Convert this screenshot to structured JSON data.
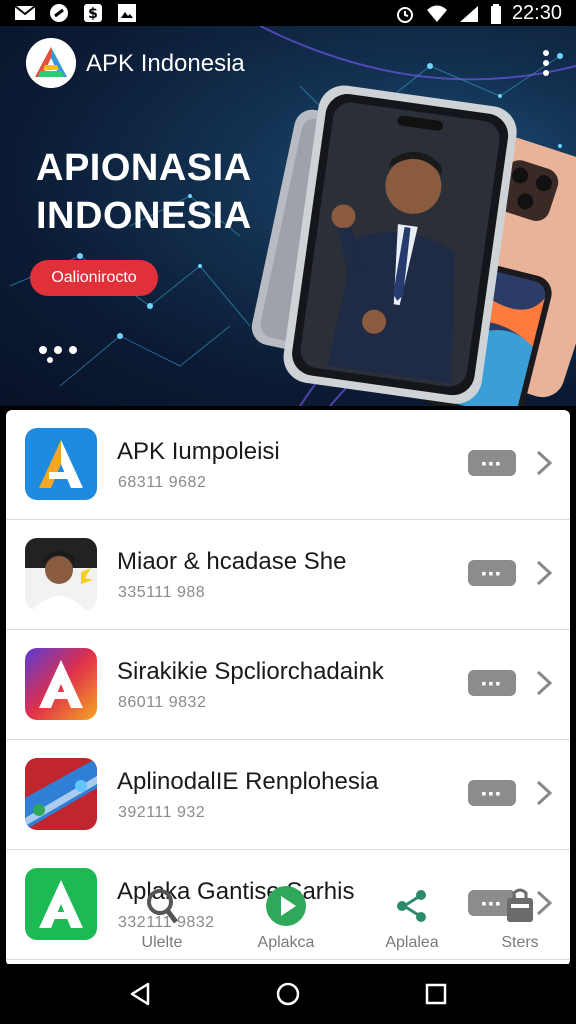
{
  "status_bar": {
    "time": "22:30",
    "left_icons": [
      "gmail-icon",
      "link-icon",
      "dollar-icon",
      "image-icon"
    ],
    "right_icons": [
      "alarm-icon",
      "wifi-icon",
      "signal-icon",
      "battery-icon"
    ]
  },
  "app_bar": {
    "title": "APK Indonesia",
    "logo_icon": "apk-logo-icon",
    "menu_icon": "more-vert-icon"
  },
  "hero": {
    "title_line1": "APIONASIA",
    "title_line2": "INDONESIA",
    "cta_label": "Oalionirocto",
    "pager_dots": 3
  },
  "apps": [
    {
      "title": "APK Iumpoleisi",
      "subtitle": "68311 9682",
      "badge": "▪▪▪",
      "icon": "apk-a-blue-icon"
    },
    {
      "title": "Miaor & hcadase She",
      "subtitle": "335111 988",
      "badge": "▪▪▪",
      "icon": "person-avatar-icon"
    },
    {
      "title": "Sirakikie Spcliorchadaink",
      "subtitle": "86011 9832",
      "badge": "▪▪▪",
      "icon": "apk-a-gradient-icon"
    },
    {
      "title": "AplinodalIE Renplohesia",
      "subtitle": "392111 932",
      "badge": "▪▪▪",
      "icon": "game-icon"
    },
    {
      "title": "Aplaka Gantise Sarhis",
      "subtitle": "332111 9832",
      "badge": "▪▪▪",
      "icon": "apk-a-green-icon"
    }
  ],
  "bottom_tabs": [
    {
      "label": "Ulelte",
      "icon": "search-icon"
    },
    {
      "label": "Aplakca",
      "icon": "play-icon"
    },
    {
      "label": "Aplalea",
      "icon": "share-icon"
    },
    {
      "label": "Sters",
      "icon": "bag-icon"
    }
  ],
  "nav_bar": {
    "icons": [
      "back-icon",
      "home-icon",
      "recents-icon"
    ]
  },
  "colors": {
    "accent_red": "#e0303a",
    "hero_bg": "#0b1a33",
    "badge_grey": "#8c8c8c",
    "tab_green": "#2fa85a"
  }
}
